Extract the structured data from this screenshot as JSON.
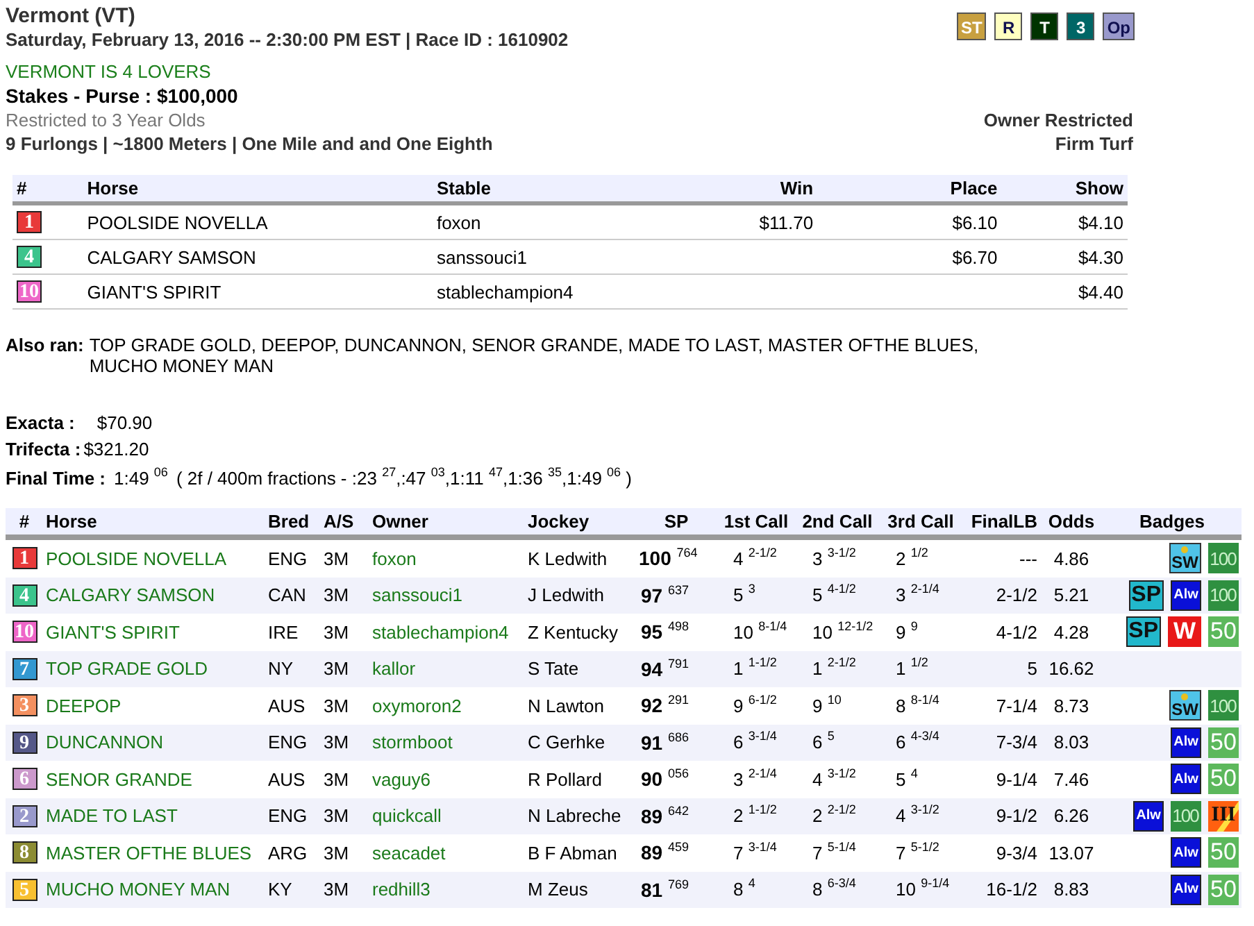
{
  "header": {
    "track": "Vermont (VT)",
    "date_line": "Saturday, February 13, 2016 -- 2:30:00 PM EST | Race ID : 1610902",
    "race_name": "VERMONT IS 4 LOVERS",
    "purse_line": "Stakes - Purse : $100,000",
    "restriction": "Restricted to 3 Year Olds",
    "distance": "9 Furlongs | ~1800 Meters | One Mile and and One Eighth",
    "owner_restriction": "Owner Restricted",
    "surface": "Firm Turf",
    "tags": [
      {
        "text": "ST",
        "color": "#c8a040",
        "kind": "light-text"
      },
      {
        "text": "R",
        "color": "#ffffc0",
        "kind": "dark-text"
      },
      {
        "text": "T",
        "color": "#003300",
        "kind": "light-text"
      },
      {
        "text": "3",
        "color": "#006666",
        "kind": "light-text"
      },
      {
        "text": "Op",
        "color": "#9999cc",
        "kind": "dark-text"
      }
    ]
  },
  "payouts": {
    "columns": [
      "#",
      "Horse",
      "Stable",
      "Win",
      "Place",
      "Show"
    ],
    "rows": [
      {
        "number": "1",
        "color": "#e83a3a",
        "horse": "POOLSIDE NOVELLA",
        "stable": "foxon",
        "win": "$11.70",
        "place": "$6.10",
        "show": "$4.10"
      },
      {
        "number": "4",
        "color": "#3cc48c",
        "horse": "CALGARY SAMSON",
        "stable": "sanssouci1",
        "place": "$6.70",
        "show": "$4.30"
      },
      {
        "number": "10",
        "color": "#ee66c8",
        "horse": "GIANT'S SPIRIT",
        "stable": "stablechampion4",
        "show": "$4.40"
      }
    ]
  },
  "summary": {
    "also_ran_label": "Also ran:",
    "also_ran": "TOP GRADE GOLD, DEEPOP, DUNCANNON, SENOR GRANDE, MADE TO LAST, MASTER OFTHE BLUES, MUCHO MONEY MAN",
    "exacta_label": "Exacta :",
    "exacta": "$70.90",
    "trifecta_label": "Trifecta :",
    "trifecta": "$321.20",
    "final_time_label": "Final Time :",
    "final_time": "1:49 $^{06}$",
    "fractions": "( 2f / 400m fractions - :23 $^{27}$,:47 $^{03}$,1:11 $^{47}$,1:36 $^{35}$,1:49 $^{06}$ )"
  },
  "results": {
    "columns": [
      "#",
      "Horse",
      "Bred",
      "A/S",
      "Owner",
      "Jockey",
      "SP",
      "1st Call",
      "2nd Call",
      "3rd Call",
      "FinalLB",
      "Odds",
      "Badges"
    ],
    "rows": [
      {
        "number": "1",
        "color": "#e83a3a",
        "horse": "POOLSIDE NOVELLA",
        "bred": "ENG",
        "as": "3M",
        "owner": "foxon",
        "jockey": "K Ledwith",
        "sp": "100 $^{764}$",
        "call_1": "4 $^{2-1/2}$",
        "call_2": "3 $^{3-1/2}$",
        "call_3": "2 $^{1/2}$",
        "final_lb": "---",
        "odds": "4.86",
        "badges": [
          {
            "kind": "sw",
            "text": "SW"
          },
          {
            "kind": "g100",
            "text": "100"
          }
        ]
      },
      {
        "number": "4",
        "color": "#3cc48c",
        "horse": "CALGARY SAMSON",
        "bred": "CAN",
        "as": "3M",
        "owner": "sanssouci1",
        "jockey": "J Ledwith",
        "sp": "97 $^{637}$",
        "call_1": "5 $^{3}$",
        "call_2": "5 $^{4-1/2}$",
        "call_3": "3 $^{2-1/4}$",
        "final_lb": "2-1/2",
        "odds": "5.21",
        "badges": [
          {
            "kind": "sp",
            "text": "SP"
          },
          {
            "kind": "alw",
            "text": "Alw"
          },
          {
            "kind": "g100",
            "text": "100"
          }
        ]
      },
      {
        "number": "10",
        "color": "#ee66c8",
        "horse": "GIANT'S SPIRIT",
        "bred": "IRE",
        "as": "3M",
        "owner": "stablechampion4",
        "jockey": "Z Kentucky",
        "sp": "95 $^{498}$",
        "call_1": "10 $^{8-1/4}$",
        "call_2": "10 $^{12-1/2}$",
        "call_3": "9 $^{9}$",
        "final_lb": "4-1/2",
        "odds": "4.28",
        "badges": [
          {
            "kind": "sp",
            "text": "SP"
          },
          {
            "kind": "w",
            "text": "W"
          },
          {
            "kind": "g50",
            "text": "50"
          }
        ]
      },
      {
        "number": "7",
        "color": "#3398d0",
        "horse": "TOP GRADE GOLD",
        "bred": "NY",
        "as": "3M",
        "owner": "kallor",
        "jockey": "S Tate",
        "sp": "94 $^{791}$",
        "call_1": "1 $^{1-1/2}$",
        "call_2": "1 $^{2-1/2}$",
        "call_3": "1 $^{1/2}$",
        "final_lb": "5",
        "odds": "16.62"
      },
      {
        "number": "3",
        "color": "#f49060",
        "horse": "DEEPOP",
        "bred": "AUS",
        "as": "3M",
        "owner": "oxymoron2",
        "jockey": "N Lawton",
        "sp": "92 $^{291}$",
        "call_1": "9 $^{6-1/2}$",
        "call_2": "9 $^{10}$",
        "call_3": "8 $^{8-1/4}$",
        "final_lb": "7-1/4",
        "odds": "8.73",
        "badges": [
          {
            "kind": "sw",
            "text": "SW"
          },
          {
            "kind": "g100",
            "text": "100"
          }
        ]
      },
      {
        "number": "9",
        "color": "#555888",
        "horse": "DUNCANNON",
        "bred": "ENG",
        "as": "3M",
        "owner": "stormboot",
        "jockey": "C Gerhke",
        "sp": "91 $^{686}$",
        "call_1": "6 $^{3-1/4}$",
        "call_2": "6 $^{5}$",
        "call_3": "6 $^{4-3/4}$",
        "final_lb": "7-3/4",
        "odds": "8.03",
        "badges": [
          {
            "kind": "alw",
            "text": "Alw"
          },
          {
            "kind": "g50",
            "text": "50"
          }
        ]
      },
      {
        "number": "6",
        "color": "#cc99cc",
        "horse": "SENOR GRANDE",
        "bred": "AUS",
        "as": "3M",
        "owner": "vaguy6",
        "jockey": "R Pollard",
        "sp": "90 $^{056}$",
        "call_1": "3 $^{2-1/4}$",
        "call_2": "4 $^{3-1/2}$",
        "call_3": "5 $^{4}$",
        "final_lb": "9-1/4",
        "odds": "7.46",
        "badges": [
          {
            "kind": "alw",
            "text": "Alw"
          },
          {
            "kind": "g50",
            "text": "50"
          }
        ]
      },
      {
        "number": "2",
        "color": "#9999cc",
        "horse": "MADE TO LAST",
        "bred": "ENG",
        "as": "3M",
        "owner": "quickcall",
        "jockey": "N Labreche",
        "sp": "89 $^{642}$",
        "call_1": "2 $^{1-1/2}$",
        "call_2": "2 $^{2-1/2}$",
        "call_3": "4 $^{3-1/2}$",
        "final_lb": "9-1/2",
        "odds": "6.26",
        "badges": [
          {
            "kind": "alw",
            "text": "Alw"
          },
          {
            "kind": "g100",
            "text": "100"
          },
          {
            "kind": "iii",
            "text": "III"
          }
        ]
      },
      {
        "number": "8",
        "color": "#8c8c33",
        "horse": "MASTER OFTHE BLUES",
        "bred": "ARG",
        "as": "3M",
        "owner": "seacadet",
        "jockey": "B F Abman",
        "sp": "89 $^{459}$",
        "call_1": "7 $^{3-1/4}$",
        "call_2": "7 $^{5-1/4}$",
        "call_3": "7 $^{5-1/2}$",
        "final_lb": "9-3/4",
        "odds": "13.07",
        "badges": [
          {
            "kind": "alw",
            "text": "Alw"
          },
          {
            "kind": "g50",
            "text": "50"
          }
        ]
      },
      {
        "number": "5",
        "color": "#f8c030",
        "horse": "MUCHO MONEY MAN",
        "bred": "KY",
        "as": "3M",
        "owner": "redhill3",
        "jockey": "M Zeus",
        "sp": "81 $^{769}$",
        "call_1": "8 $^{4}$",
        "call_2": "8 $^{6-3/4}$",
        "call_3": "10 $^{9-1/4}$",
        "final_lb": "16-1/2",
        "odds": "8.83",
        "badges": [
          {
            "kind": "alw",
            "text": "Alw"
          },
          {
            "kind": "g50",
            "text": "50"
          }
        ]
      }
    ]
  }
}
